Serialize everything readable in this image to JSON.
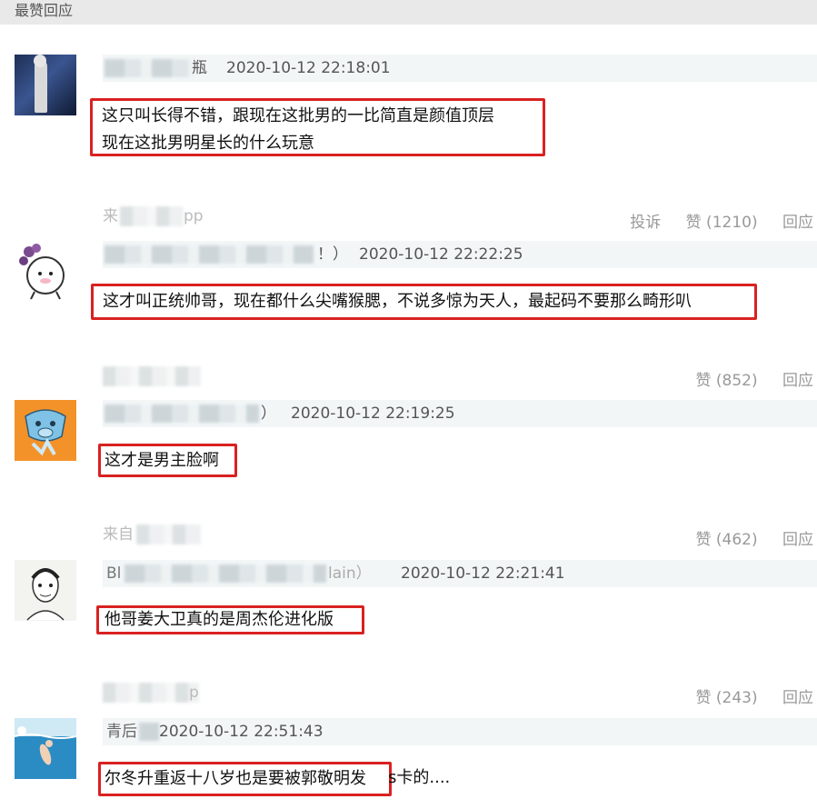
{
  "header": {
    "title": "最赞回应"
  },
  "comments": [
    {
      "timestamp": "2020-10-12 22:18:01",
      "username_visible": "瓶",
      "text_lines": [
        "这只叫长得不错，跟现在这批男的一比简直是颜值顶层",
        "现在这批男明星长的什么玩意"
      ],
      "source_visible": "来",
      "source_suffix": "pp"
    },
    {
      "timestamp": "2020-10-12 22:22:25",
      "username_visible": "！）",
      "text_lines": [
        "这才叫正统帅哥，现在都什么尖嘴猴腮，不说多惊为天人，最起码不要那么畸形叭"
      ],
      "actions": {
        "report": "投诉",
        "likes": "赞 (1210)",
        "reply": "回应"
      }
    },
    {
      "timestamp": "2020-10-12 22:19:25",
      "username_visible": "）",
      "text_lines": [
        "这才是男主脸啊"
      ],
      "actions": {
        "likes": "赞 (852)",
        "reply": "回应"
      }
    },
    {
      "timestamp": "2020-10-12 22:21:41",
      "username_visible": "Bl",
      "username_suffix": "lain）",
      "text_lines": [
        "他哥姜大卫真的是周杰伦进化版"
      ],
      "source_visible": "来自",
      "actions": {
        "likes": "赞 (462)",
        "reply": "回应"
      }
    },
    {
      "timestamp": "2020-10-12 22:51:43",
      "username_visible": "青后",
      "text_lines": [
        "尔冬升重返十八岁也是要被郭敬明发"
      ],
      "text_after": "s卡的....",
      "source_suffix": "p",
      "actions": {
        "likes": "赞 (243)",
        "reply": "回应"
      }
    }
  ],
  "colors": {
    "highlight_border": "#d92121",
    "meta_bg": "#f2f6f7",
    "header_bg": "#e9e9e9"
  }
}
